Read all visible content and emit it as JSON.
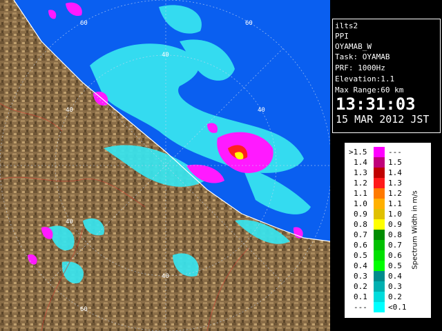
{
  "radar": {
    "range_labels": [
      "60",
      "60",
      "40",
      "40",
      "40",
      "40",
      "40",
      "60"
    ]
  },
  "info": {
    "host": "ilts2",
    "mode": "PPI",
    "product": "OYAMAB_W",
    "task": "Task: OYAMAB",
    "prf": "PRF: 1000Hz",
    "elevation": "Elevation:1.1",
    "max_range": "Max Range:60 km",
    "time": "13:31:03",
    "date": "15 MAR 2012 JST"
  },
  "legend": {
    "title": "Spectrum Width in m/s",
    "rows": [
      {
        "left": ">1.5",
        "right": "---",
        "color": "#ff00ff"
      },
      {
        "left": "1.4",
        "right": "1.5",
        "color": "#c0007a"
      },
      {
        "left": "1.3",
        "right": "1.4",
        "color": "#c00000"
      },
      {
        "left": "1.2",
        "right": "1.3",
        "color": "#ff1a1a"
      },
      {
        "left": "1.1",
        "right": "1.2",
        "color": "#ff7a00"
      },
      {
        "left": "1.0",
        "right": "1.1",
        "color": "#ffb000"
      },
      {
        "left": "0.9",
        "right": "1.0",
        "color": "#e0c000"
      },
      {
        "left": "0.8",
        "right": "0.9",
        "color": "#ffff00"
      },
      {
        "left": "0.7",
        "right": "0.8",
        "color": "#008c00"
      },
      {
        "left": "0.6",
        "right": "0.7",
        "color": "#00c000"
      },
      {
        "left": "0.5",
        "right": "0.6",
        "color": "#00e000"
      },
      {
        "left": "0.4",
        "right": "0.5",
        "color": "#00ff00"
      },
      {
        "left": "0.3",
        "right": "0.4",
        "color": "#008c8c"
      },
      {
        "left": "0.2",
        "right": "0.3",
        "color": "#00b0b0"
      },
      {
        "left": "0.1",
        "right": "0.2",
        "color": "#00dcdc"
      },
      {
        "left": "---",
        "right": "<0.1",
        "color": "#00ffff"
      }
    ]
  },
  "colors": {
    "sea": "#0a5ff0",
    "land": "#8a6d47",
    "echo_weak": "#38e6f0",
    "echo_strong": "#ff1aff"
  }
}
